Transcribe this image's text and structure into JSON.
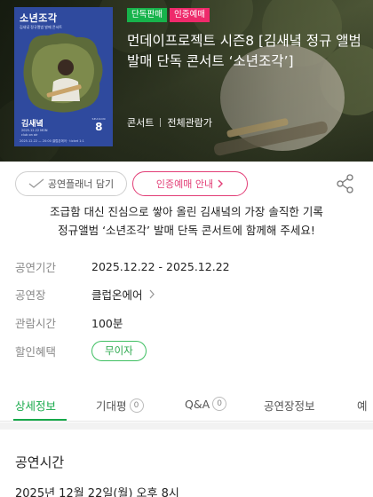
{
  "hero": {
    "poster": {
      "title": "소년조각",
      "subtitle": "김새녘 정규앨범 발매 콘서트",
      "artist": "김새녘",
      "date_text": "2025.12.22 MON\nclub on air",
      "number": "8",
      "number_caption": "SEASON",
      "footer": "2025.12.22 — 20:00 클럽온에어 · ticket 1:1"
    },
    "badges": [
      "단독판매",
      "인증예매"
    ],
    "title": "먼데이프로젝트 시즌8 [김새녘 정규 앨범 발매 단독 콘서트 ‘소년조각’]",
    "genre": "콘서트",
    "rating": "전체관람가"
  },
  "actions": {
    "planner_label": "공연플래너 담기",
    "cert_label": "인증예매 안내",
    "planner_icon": "heart-check-icon",
    "share_icon": "share-icon"
  },
  "intro": {
    "line1": "조급함 대신 진심으로 쌓아 올린 김새녘의 가장 솔직한 기록",
    "line2": "정규앨범 ‘소년조각’ 발매 단독 콘서트에 함께해 주세요!"
  },
  "info": {
    "period_label": "공연기간",
    "period_value": "2025.12.22 - 2025.12.22",
    "venue_label": "공연장",
    "venue_value": "클럽온에어",
    "runtime_label": "관람시간",
    "runtime_value": "100분",
    "discount_label": "할인혜택",
    "discount_value": "무이자"
  },
  "tabs": [
    {
      "label": "상세정보",
      "active": true
    },
    {
      "label": "기대평",
      "count": "0"
    },
    {
      "label": "Q&A",
      "count": "0"
    },
    {
      "label": "공연장정보"
    },
    {
      "label": "예"
    }
  ],
  "detail": {
    "section_title": "공연시간",
    "section_text": "2025년 12월 22일(월) 오후 8시"
  },
  "colors": {
    "accent_green": "#17a94a",
    "badge_green": "#17b34b",
    "badge_pink": "#ee2a6b",
    "cert_pink": "#e23d76"
  }
}
